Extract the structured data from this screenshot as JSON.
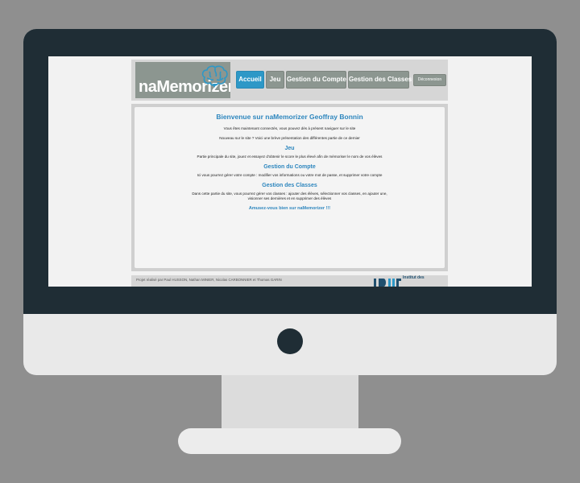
{
  "logo": {
    "prefix": "na",
    "name": "Memorizer"
  },
  "nav": {
    "items": [
      "Accueil",
      "Jeu",
      "Gestion du Compte",
      "Gestion des Classes"
    ],
    "active": "Accueil",
    "logout": "Déconnexion"
  },
  "content": {
    "title": "Bienvenue sur naMemorizer Geoffray Bonnin",
    "intro1": "Vous êtes maintenant connectés, vous pouvez dès à présent naviguer sur le site",
    "intro2": "Nouveau sur le site ? Voici une brève présentation des différentes partie de ce dernier",
    "sections": [
      {
        "title": "Jeu",
        "text": "Partie principale du site, jouez et essayez d'obtenir le score le plus élevé afin de mémoriser le nom de vos élèves"
      },
      {
        "title": "Gestion du Compte",
        "text": "Ici vous pourrez gérer votre compte : modifier vos informations ou votre mot de passe, et supprimer votre compte"
      },
      {
        "title": "Gestion des Classes",
        "text": "Dans cette partie du site, vous pourrez gérer vos classes : ajouter des élèves, sélectionner vos classes, en ajouter une, visionner ses dernières et en supprimer des élèves"
      }
    ],
    "closing": "Amusez-vous bien sur naMemorizer !!!"
  },
  "footer": {
    "credits": "Projet réalisé par Paul HUSSON, Nathan MINIER, Nicolas CARBONNIER et Thomas GARIN",
    "institute": "Institut des"
  },
  "colors": {
    "accent": "#2d86be",
    "nav": "#8c9690",
    "bezel": "#1f2d35"
  }
}
